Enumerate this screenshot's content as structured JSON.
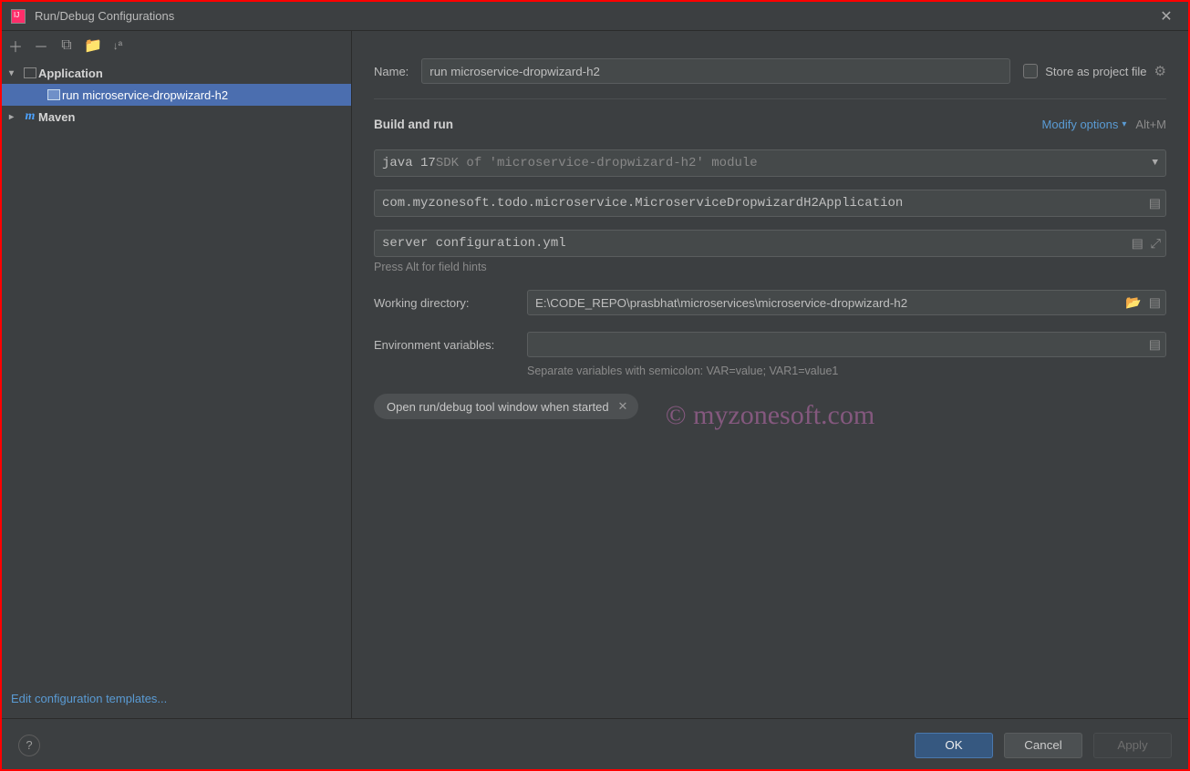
{
  "window": {
    "title": "Run/Debug Configurations"
  },
  "sidebar": {
    "icons": [
      "add",
      "remove",
      "copy",
      "folder",
      "sort"
    ],
    "groups": [
      {
        "label": "Application",
        "expanded": true,
        "items": [
          {
            "label": "run microservice-dropwizard-h2",
            "selected": true
          }
        ]
      },
      {
        "label": "Maven",
        "expanded": false,
        "items": []
      }
    ],
    "footer_link": "Edit configuration templates..."
  },
  "form": {
    "name_label": "Name:",
    "name_value": "run microservice-dropwizard-h2",
    "store_as_project_file": "Store as project file",
    "section_title": "Build and run",
    "modify_options": "Modify options",
    "modify_shortcut": "Alt+M",
    "jdk_prefix": "java 17",
    "jdk_suffix": " SDK of 'microservice-dropwizard-h2' module",
    "main_class": "com.myzonesoft.todo.microservice.MicroserviceDropwizardH2Application",
    "program_args": "server configuration.yml",
    "hint_alt": "Press Alt for field hints",
    "working_dir_label": "Working directory:",
    "working_dir_value": "E:\\CODE_REPO\\prasbhat\\microservices\\microservice-dropwizard-h2",
    "env_label": "Environment variables:",
    "env_value": "",
    "env_hint": "Separate variables with semicolon: VAR=value; VAR1=value1",
    "chip": "Open run/debug tool window when started"
  },
  "footer": {
    "ok": "OK",
    "cancel": "Cancel",
    "apply": "Apply"
  },
  "watermark": "© myzonesoft.com"
}
